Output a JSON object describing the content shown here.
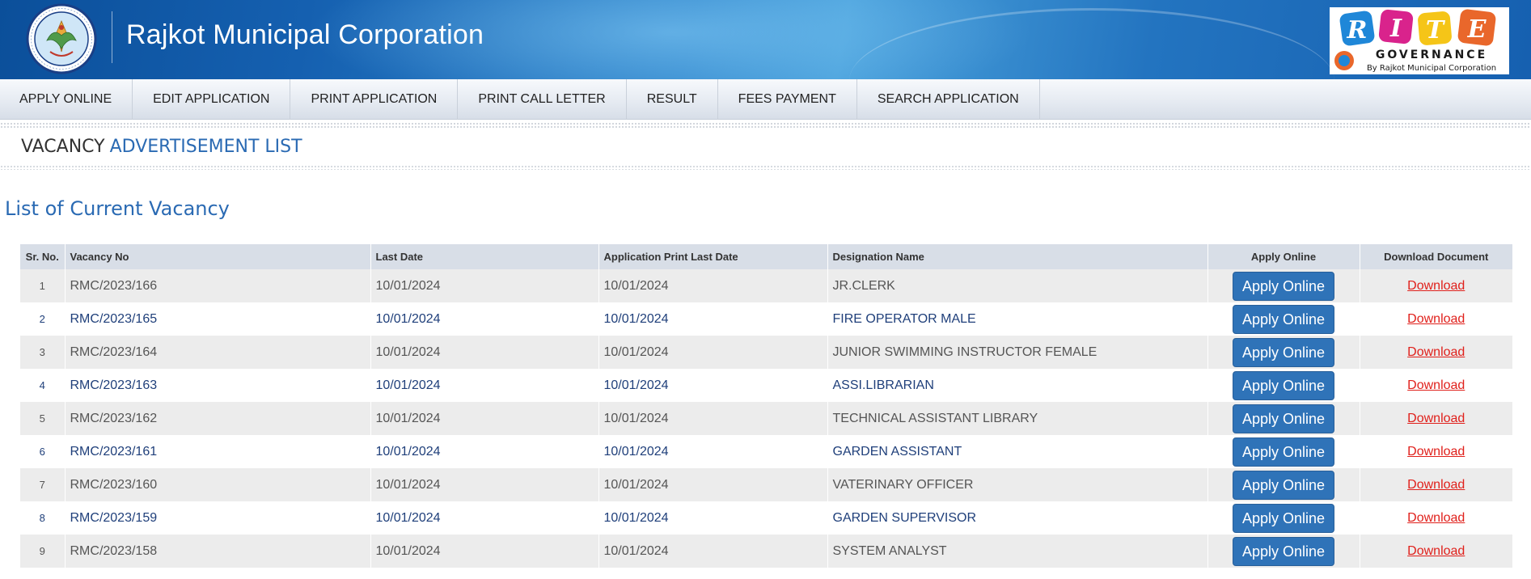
{
  "header": {
    "title": "Rajkot Municipal Corporation",
    "rite_logo": {
      "letters": [
        "R",
        "I",
        "T",
        "E"
      ],
      "subtitle": "GOVERNANCE",
      "tagline": "By Rajkot Municipal Corporation"
    },
    "seal_icon": "rmc-seal-icon"
  },
  "nav": {
    "items": [
      {
        "label": "APPLY ONLINE"
      },
      {
        "label": "EDIT APPLICATION"
      },
      {
        "label": "PRINT APPLICATION"
      },
      {
        "label": "PRINT CALL LETTER"
      },
      {
        "label": "RESULT"
      },
      {
        "label": "FEES PAYMENT"
      },
      {
        "label": "SEARCH APPLICATION"
      }
    ]
  },
  "page": {
    "heading_part1": "VACANCY",
    "heading_part2": "ADVERTISEMENT LIST",
    "section_title": "List of Current Vacancy"
  },
  "table": {
    "headers": {
      "sr": "Sr. No.",
      "vacancy": "Vacancy No",
      "last_date": "Last Date",
      "print_last_date": "Application Print Last Date",
      "designation": "Designation Name",
      "apply": "Apply Online",
      "download": "Download Document"
    },
    "rows": [
      {
        "sr": "1",
        "vacancy": "RMC/2023/166",
        "last_date": "10/01/2024",
        "print_last_date": "10/01/2024",
        "designation": "JR.CLERK",
        "apply": "Apply Online",
        "download": "Download"
      },
      {
        "sr": "2",
        "vacancy": "RMC/2023/165",
        "last_date": "10/01/2024",
        "print_last_date": "10/01/2024",
        "designation": "FIRE OPERATOR MALE",
        "apply": "Apply Online",
        "download": "Download"
      },
      {
        "sr": "3",
        "vacancy": "RMC/2023/164",
        "last_date": "10/01/2024",
        "print_last_date": "10/01/2024",
        "designation": "JUNIOR SWIMMING INSTRUCTOR FEMALE",
        "apply": "Apply Online",
        "download": "Download"
      },
      {
        "sr": "4",
        "vacancy": "RMC/2023/163",
        "last_date": "10/01/2024",
        "print_last_date": "10/01/2024",
        "designation": "ASSI.LIBRARIAN",
        "apply": "Apply Online",
        "download": "Download"
      },
      {
        "sr": "5",
        "vacancy": "RMC/2023/162",
        "last_date": "10/01/2024",
        "print_last_date": "10/01/2024",
        "designation": "TECHNICAL ASSISTANT LIBRARY",
        "apply": "Apply Online",
        "download": "Download"
      },
      {
        "sr": "6",
        "vacancy": "RMC/2023/161",
        "last_date": "10/01/2024",
        "print_last_date": "10/01/2024",
        "designation": "GARDEN ASSISTANT",
        "apply": "Apply Online",
        "download": "Download"
      },
      {
        "sr": "7",
        "vacancy": "RMC/2023/160",
        "last_date": "10/01/2024",
        "print_last_date": "10/01/2024",
        "designation": "VATERINARY OFFICER",
        "apply": "Apply Online",
        "download": "Download"
      },
      {
        "sr": "8",
        "vacancy": "RMC/2023/159",
        "last_date": "10/01/2024",
        "print_last_date": "10/01/2024",
        "designation": "GARDEN SUPERVISOR",
        "apply": "Apply Online",
        "download": "Download"
      },
      {
        "sr": "9",
        "vacancy": "RMC/2023/158",
        "last_date": "10/01/2024",
        "print_last_date": "10/01/2024",
        "designation": "SYSTEM ANALYST",
        "apply": "Apply Online",
        "download": "Download"
      }
    ]
  },
  "colors": {
    "header_blue": "#1560b0",
    "accent_blue": "#2a6ab3",
    "button_blue": "#2f73b8",
    "download_red": "#e0201b",
    "row_stripe": "#ececec"
  }
}
